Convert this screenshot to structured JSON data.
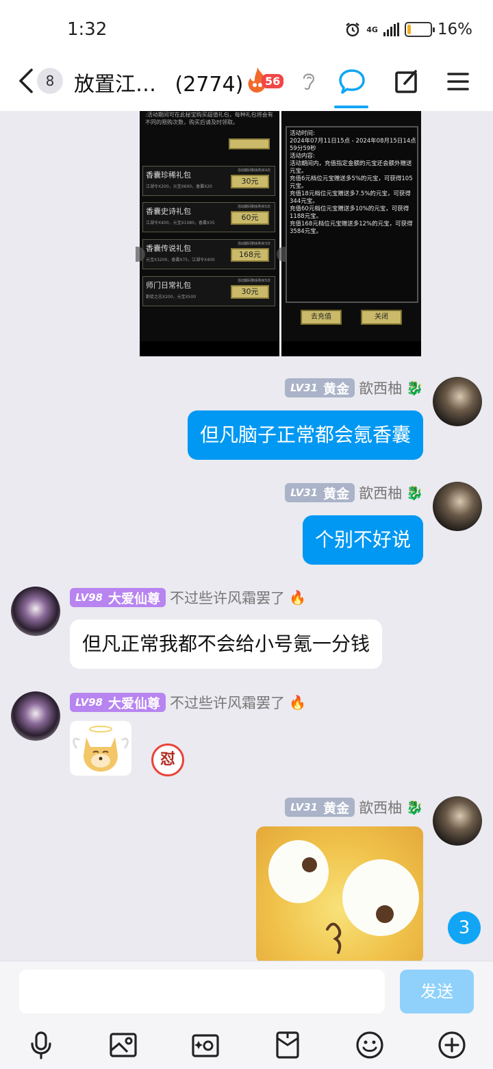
{
  "status_bar": {
    "time": "1:32",
    "network": "4G",
    "battery": "16%",
    "battery_level": 0.16
  },
  "header": {
    "unread_count": "8",
    "title": "放置江…",
    "member_count": "(2774)",
    "fire_level": "56"
  },
  "embedded_screenshots": {
    "left": {
      "top_text": ":活动期间可在此秘宝购买超值礼包，每种礼包将会有不同的限购次数，购买后请及时领取。",
      "gifts": [
        {
          "name": "香囊珍稀礼包",
          "contents": "江湖令X200，元宝X600，香囊X20",
          "limit": "活动期间剩余购买4次",
          "price": "30元"
        },
        {
          "name": "香囊史诗礼包",
          "contents": "江湖令X400，元宝X1080，香囊X35",
          "limit": "活动期间剩余购买5次",
          "price": "60元"
        },
        {
          "name": "香囊传说礼包",
          "contents": "元宝X3200，香囊X75，江湖令X400",
          "limit": "活动期间剩余购买3次",
          "price": "168元"
        },
        {
          "name": "师门日常礼包",
          "contents": "勤徒之志X200，元宝X500",
          "limit": "活动期间剩余购买5次",
          "price": "30元"
        }
      ]
    },
    "right": {
      "panel_text": "活动时间:\n2024年07月11日15点 - 2024年08月15日14点59分59秒\n活动内容:\n活动期间内，充值指定金额的元宝还会额外赠送元宝。\n充值6元档位元宝赠送多5%的元宝，可获得105元宝。\n充值18元档位元宝赠送多7.5%的元宝，可获得344元宝。\n充值60元档位元宝赠送多10%的元宝，可获得1188元宝。\n充值168元档位元宝赠送多12%的元宝，可获得3584元宝。",
      "buttons": [
        "去充值",
        "关闭"
      ]
    }
  },
  "messages": [
    {
      "sender_level": "LV31",
      "sender_title": "黄金",
      "sender_nick": "歆西柚",
      "side": "right",
      "text": "但凡脑子正常都会氪香囊"
    },
    {
      "sender_level": "LV31",
      "sender_title": "黄金",
      "sender_nick": "歆西柚",
      "side": "right",
      "text": "个别不好说"
    },
    {
      "sender_level": "LV98",
      "sender_title": "大爱仙尊",
      "sender_nick": "不过些许风霜罢了",
      "side": "left",
      "text": "但凡正常我都不会给小号氪一分钱"
    },
    {
      "sender_level": "LV98",
      "sender_title": "大爱仙尊",
      "sender_nick": "不过些许风霜罢了",
      "side": "left",
      "sticker": "angel-dog-sticker",
      "reaction_badge": "怼"
    },
    {
      "sender_level": "LV31",
      "sender_title": "黄金",
      "sender_nick": "歆西柚",
      "side": "right",
      "sticker": "googly-eyes-face-sticker"
    }
  ],
  "unread_bubble": "3",
  "composer": {
    "placeholder": "",
    "send_label": "发送"
  },
  "toolbar_icons": [
    "microphone-icon",
    "image-icon",
    "camera-icon",
    "red-packet-icon",
    "emoji-icon",
    "plus-icon"
  ],
  "colors": {
    "accent": "#12a5f6",
    "bubble_out": "#0098f2",
    "lvl_gold": "#aab3c8",
    "lvl_purple": "#b784f0"
  }
}
